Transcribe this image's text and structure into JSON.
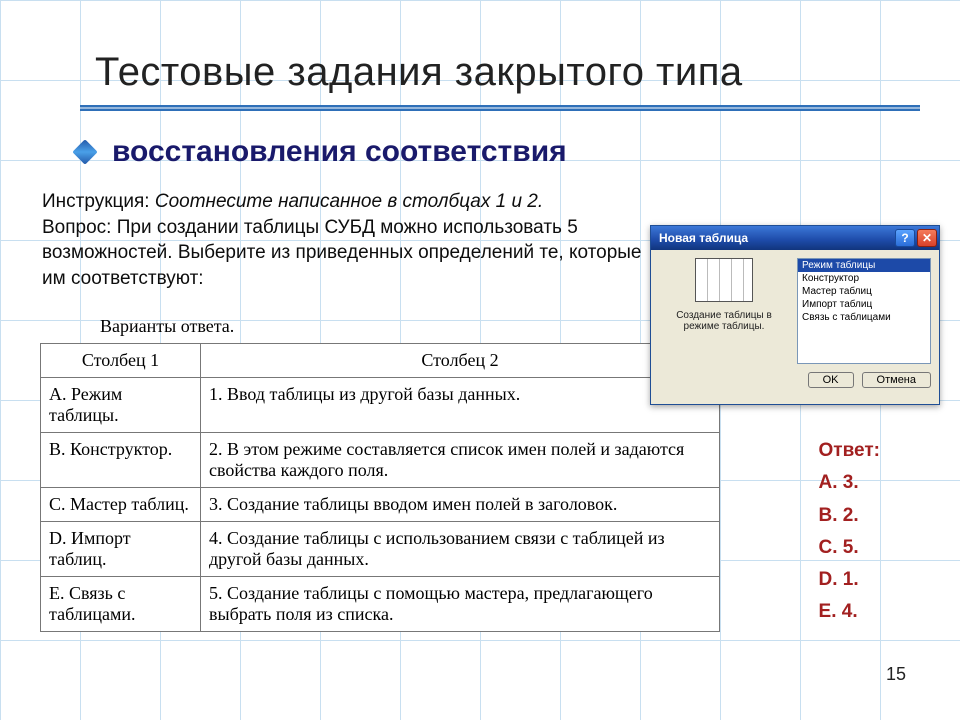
{
  "title": "Тестовые задания закрытого типа",
  "subtitle": "восстановления соответствия",
  "instruction_label": "Инструкция:",
  "instruction_text": "Соотнесите написанное в столбцах 1 и 2.",
  "question_label": "Вопрос:",
  "question_text": "При создании таблицы СУБД можно использовать 5 возможностей. Выберите из приведенных определений те, которые им соответствуют:",
  "variants_caption": "Варианты ответа.",
  "columns": {
    "col1": "Столбец 1",
    "col2": "Столбец 2"
  },
  "rows": [
    {
      "c1": "A. Режим таблицы.",
      "c2": "1. Ввод таблицы из другой базы данных."
    },
    {
      "c1": "B. Конструктор.",
      "c2": "2. В этом режиме составляется список имен полей и задаются свойства каждого поля."
    },
    {
      "c1": "C. Мастер таблиц.",
      "c2": "3. Создание таблицы вводом имен полей в заголовок."
    },
    {
      "c1": "D. Импорт таблиц.",
      "c2": "4. Создание таблицы с использованием связи с таблицей из другой базы данных."
    },
    {
      "c1": "E. Связь с таблицами.",
      "c2": "5. Создание таблицы с помощью мастера, предлагающего выбрать поля из списка."
    }
  ],
  "dialog": {
    "title": "Новая таблица",
    "caption": "Создание таблицы в режиме таблицы.",
    "list": [
      "Режим таблицы",
      "Конструктор",
      "Мастер таблиц",
      "Импорт таблиц",
      "Связь с таблицами"
    ],
    "ok": "OK",
    "cancel": "Отмена",
    "help": "?",
    "close": "✕"
  },
  "answers": {
    "label": "Ответ:",
    "items": [
      "A. 3.",
      "B. 2.",
      "C. 5.",
      "D. 1.",
      "E. 4."
    ]
  },
  "page_number": "15"
}
